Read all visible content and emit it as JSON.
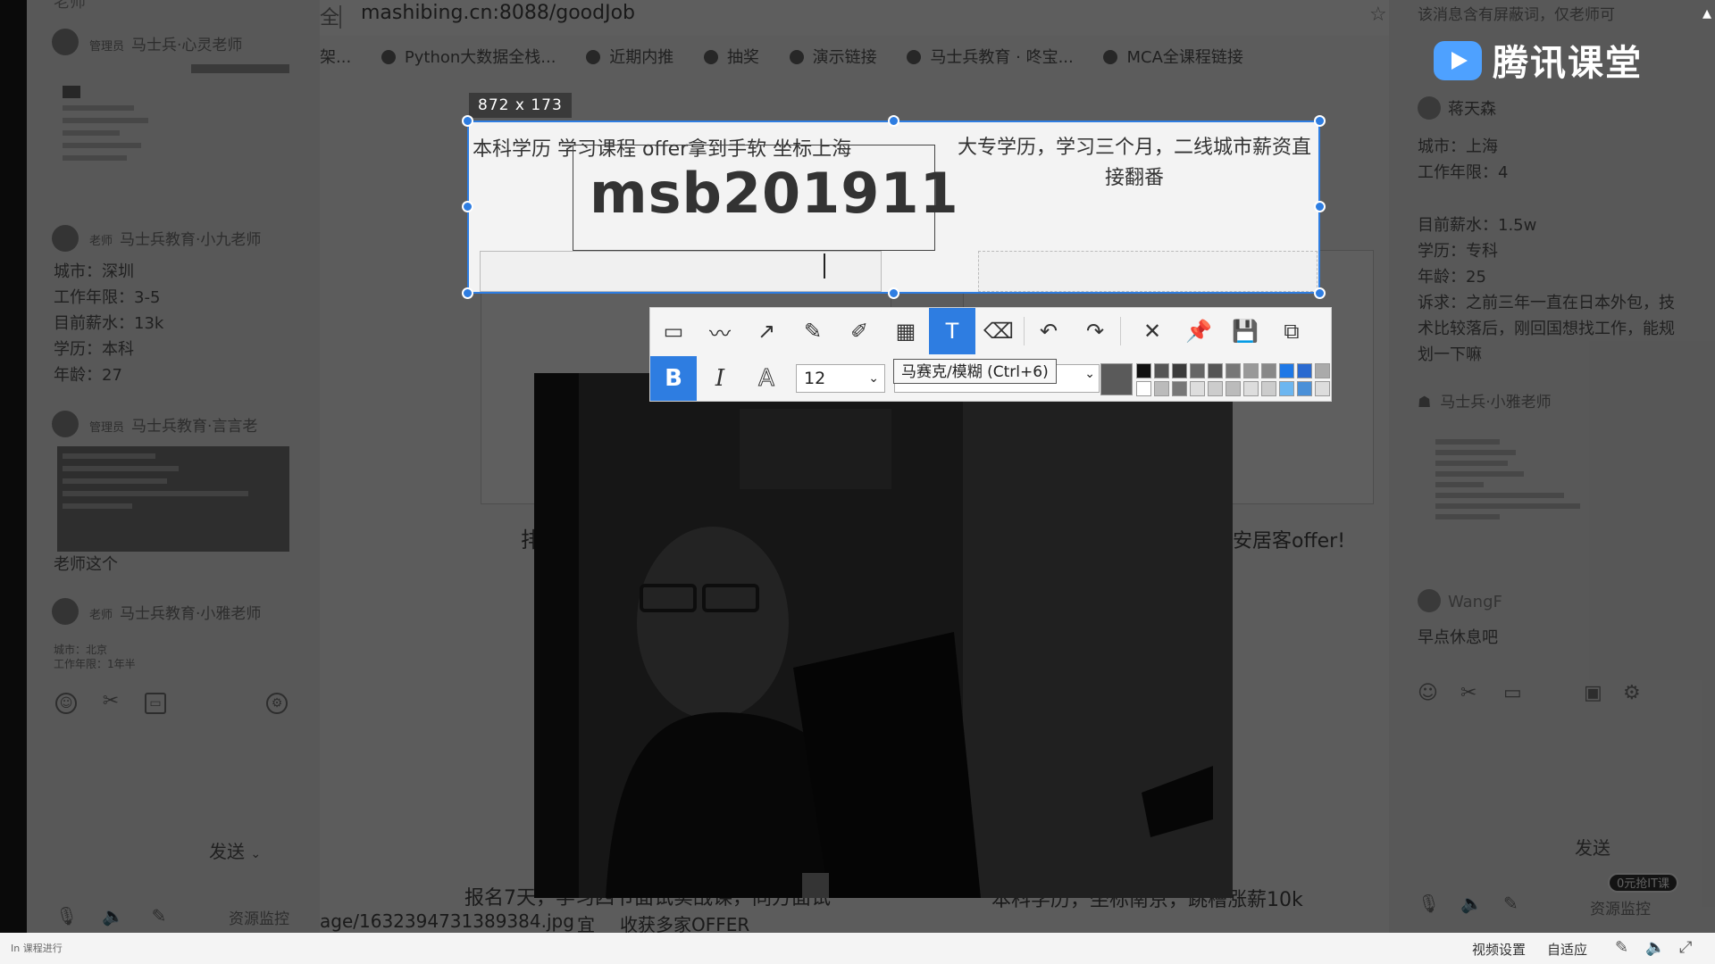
{
  "browser": {
    "url": "mashibing.cn:8088/goodJob",
    "url_prefix": "全",
    "bookmarks": [
      "Python大数据全栈...",
      "近期内推",
      "抽奖",
      "演示链接",
      "马士兵教育 · 咚宝...",
      "MCA全课程链接"
    ],
    "bookmark_prefix": "架...",
    "page_texts": {
      "left_card_top": "本科学历 学习课程 offer拿到手软 坐标上海",
      "right_card_top": "大专学历，学习三个月，二线城市薪资直接翻番",
      "bottom_left": "报名7天，学习四节面试实战课，同方面试",
      "bottom_right": "本科学历，坐标南京，跳槽涨薪10k",
      "bottom_link": "age/1632394731389384.jpg",
      "bottom_mid_a": "宜",
      "bottom_mid_b": "收获多家OFFER",
      "mid_right": "安居客offer!",
      "mid_left": "排"
    }
  },
  "capture": {
    "size_label": "872 x 173",
    "text_value": "msb201911"
  },
  "toolbar": {
    "tools": [
      "rectangle-tool",
      "polyline-tool",
      "arrow-tool",
      "pencil-tool",
      "marker-tool",
      "mosaic-tool",
      "text-tool",
      "eraser-tool",
      "undo",
      "redo",
      "cancel",
      "pin",
      "save",
      "copy"
    ],
    "active_tool": "text-tool",
    "bold_label": "B",
    "italic_label": "I",
    "outline_label": "A",
    "font_size": "12",
    "tooltip": "马赛克/模糊 (Ctrl+6)",
    "current_color": "#5a5a5a",
    "palette_top": [
      "#111111",
      "#555555",
      "#3a3a3a",
      "#666666",
      "#555555",
      "#777777",
      "#999999",
      "#888888",
      "#1e78e6",
      "#2a6ad0",
      "#aaaaaa"
    ],
    "palette_bottom": [
      "#ffffff",
      "#bbbbbb",
      "#777777",
      "#dddddd",
      "#cccccc",
      "#bbbbbb",
      "#dddddd",
      "#cccccc",
      "#6cb6f0",
      "#4a90d8",
      "#dddddd"
    ]
  },
  "left_panel": {
    "top_clip": "老师",
    "msg1_name": "马士兵·心灵老师",
    "msg1_tag": "管理员",
    "msg2_name": "马士兵教育·小九老师",
    "msg2_tag": "老师",
    "msg2_lines": [
      "城市：深圳",
      "工作年限：3-5",
      "目前薪水：13k",
      "学历：本科",
      "年龄：27"
    ],
    "msg3_name": "马士兵教育·言言老",
    "msg3_tag": "管理员",
    "msg3_follow": "老师这个",
    "msg4_name": "马士兵教育·小雅老师",
    "msg4_tag": "老师",
    "msg4_lines": [
      "城市：北京",
      "工作年限：1年半"
    ],
    "send_label": "发送",
    "resource_label": "资源监控"
  },
  "right_panel": {
    "notice": "该消息含有屏蔽词，仅老师可",
    "user_name": "蒋天森",
    "lines": [
      "城市：上海",
      "工作年限：4",
      "目前薪水：1.5w",
      "学历：专科",
      "年龄：25",
      "诉求：之前三年一直在日本外包，技术比较落后，刚回国想找工作，能规划一下嘛"
    ],
    "teacher": "马士兵·小雅老师",
    "wangf": "WangF",
    "wangf_msg": "早点休息吧",
    "send_label": "发送",
    "resource_label": "资源监控",
    "badge": "0元抢IT课"
  },
  "logo_text": "腾讯课堂",
  "statusbar": {
    "left": "In 课程进行",
    "video_settings": "视频设置",
    "auto_fit": "自适应"
  }
}
